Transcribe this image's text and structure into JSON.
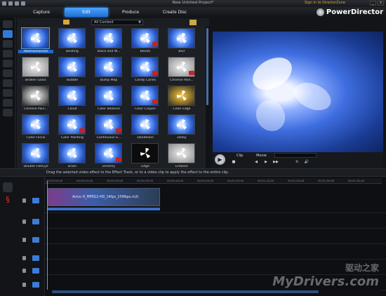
{
  "window": {
    "title": "New Untitled Project*",
    "signin_link": "Sign in to DirectorZone",
    "brand": "PowerDirector",
    "min_label": "_",
    "close_label": "x"
  },
  "tabs": [
    {
      "label": "Capture"
    },
    {
      "label": "Edit",
      "active": true
    },
    {
      "label": "Produce"
    },
    {
      "label": "Create Disc"
    }
  ],
  "library": {
    "content_filter": "All Content",
    "caret": "▼",
    "effects": [
      {
        "label": "Abstractionism",
        "selected": true
      },
      {
        "label": "Beating"
      },
      {
        "label": "Black and W..."
      },
      {
        "label": "Bloom"
      },
      {
        "label": "Blur"
      },
      {
        "label": "Broken Glass"
      },
      {
        "label": "Bubble"
      },
      {
        "label": "Bump Map"
      },
      {
        "label": "Candy Canes"
      },
      {
        "label": "Chinese Pain..."
      },
      {
        "label": "Chinese Pain..."
      },
      {
        "label": "Cloud"
      },
      {
        "label": "Color Balance"
      },
      {
        "label": "Color Crayon"
      },
      {
        "label": "Color Edge"
      },
      {
        "label": "Color Focus"
      },
      {
        "label": "Color Painting"
      },
      {
        "label": "Continuous S..."
      },
      {
        "label": "Dandelion"
      },
      {
        "label": "Delay"
      },
      {
        "label": "Double FishEye"
      },
      {
        "label": "Drain"
      },
      {
        "label": "Dreamy"
      },
      {
        "label": "Edge"
      },
      {
        "label": "Emboss"
      }
    ]
  },
  "player": {
    "mode_clip": "Clip",
    "mode_movie": "Movie",
    "play_symbol": "▶",
    "controls": [
      "■",
      "◀",
      "▶",
      "▶▶",
      "⟲",
      "🔊"
    ]
  },
  "hint": "Drag the selected video effect to the Effect Track, or to a video clip to apply the effect to the entire clip.",
  "timeline": {
    "ticks": [
      "00;00;00;00",
      "00;00;10;00",
      "00;00;20;00",
      "00;00;30;00",
      "00;00;40;00",
      "00;00;50;00",
      "00;01;00;00",
      "00;01;10;00",
      "00;01;20;00",
      "00;01;30;00",
      "00;01;40;00"
    ],
    "clip_name": "Avivo H_MPEG2-HD_24fps_25Mbps.m2t"
  },
  "watermark": {
    "cn": "驱动之家",
    "en": "MyDrivers.com"
  }
}
